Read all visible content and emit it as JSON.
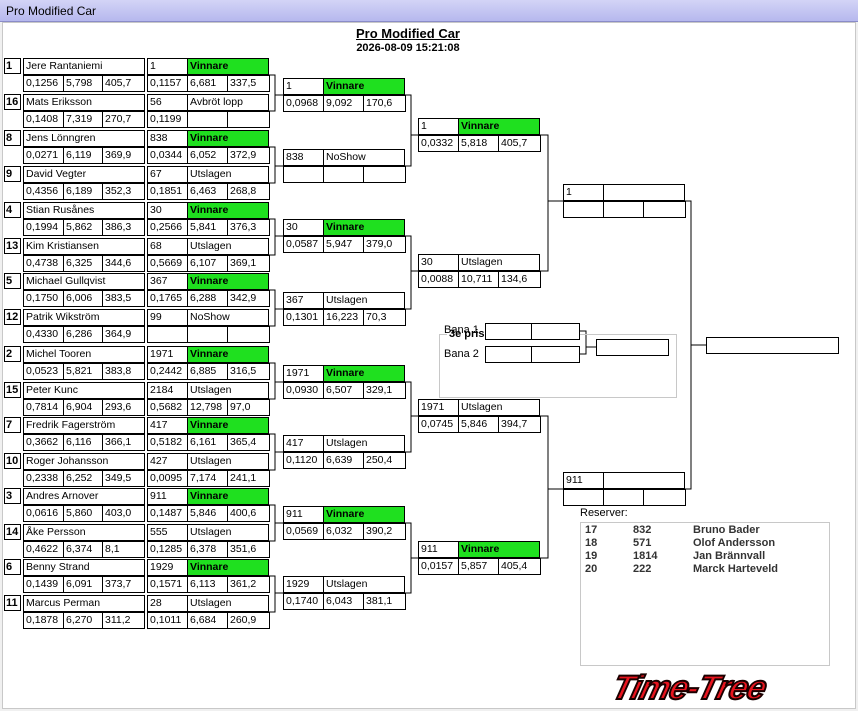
{
  "window": {
    "title": "Pro Modified Car"
  },
  "header": {
    "title": "Pro Modified Car",
    "datetime": "2026-08-09 15:21:08"
  },
  "round1": [
    {
      "seed": "1",
      "name": "Jere Rantaniemi",
      "stats": [
        "0,1256",
        "5,798",
        "405,7"
      ],
      "car": "1",
      "result": "Vinnare",
      "win": true,
      "rstats": [
        "0,1157",
        "6,681",
        "337,5"
      ]
    },
    {
      "seed": "16",
      "name": "Mats Eriksson",
      "stats": [
        "0,1408",
        "7,319",
        "270,7"
      ],
      "car": "56",
      "result": "Avbröt lopp",
      "win": false,
      "rstats": [
        "0,1199",
        "",
        ""
      ]
    },
    {
      "seed": "8",
      "name": "Jens Lönngren",
      "stats": [
        "0,0271",
        "6,119",
        "369,9"
      ],
      "car": "838",
      "result": "Vinnare",
      "win": true,
      "rstats": [
        "0,0344",
        "6,052",
        "372,9"
      ]
    },
    {
      "seed": "9",
      "name": "David Vegter",
      "stats": [
        "0,4356",
        "6,189",
        "352,3"
      ],
      "car": "67",
      "result": "Utslagen",
      "win": false,
      "rstats": [
        "0,1851",
        "6,463",
        "268,8"
      ]
    },
    {
      "seed": "4",
      "name": "Stian Rusånes",
      "stats": [
        "0,1994",
        "5,862",
        "386,3"
      ],
      "car": "30",
      "result": "Vinnare",
      "win": true,
      "rstats": [
        "0,2566",
        "5,841",
        "376,3"
      ]
    },
    {
      "seed": "13",
      "name": "Kim Kristiansen",
      "stats": [
        "0,4738",
        "6,325",
        "344,6"
      ],
      "car": "68",
      "result": "Utslagen",
      "win": false,
      "rstats": [
        "0,5669",
        "6,107",
        "369,1"
      ]
    },
    {
      "seed": "5",
      "name": "Michael Gullqvist",
      "stats": [
        "0,1750",
        "6,006",
        "383,5"
      ],
      "car": "367",
      "result": "Vinnare",
      "win": true,
      "rstats": [
        "0,1765",
        "6,288",
        "342,9"
      ]
    },
    {
      "seed": "12",
      "name": "Patrik Wikström",
      "stats": [
        "0,4330",
        "6,286",
        "364,9"
      ],
      "car": "99",
      "result": "NoShow",
      "win": false,
      "rstats": [
        "",
        "",
        ""
      ]
    },
    {
      "seed": "2",
      "name": "Michel Tooren",
      "stats": [
        "0,0523",
        "5,821",
        "383,8"
      ],
      "car": "1971",
      "result": "Vinnare",
      "win": true,
      "rstats": [
        "0,2442",
        "6,885",
        "316,5"
      ]
    },
    {
      "seed": "15",
      "name": "Peter  Kunc",
      "stats": [
        "0,7814",
        "6,904",
        "293,6"
      ],
      "car": "2184",
      "result": "Utslagen",
      "win": false,
      "rstats": [
        "0,5682",
        "12,798",
        "97,0"
      ]
    },
    {
      "seed": "7",
      "name": "Fredrik Fagerström",
      "stats": [
        "0,3662",
        "6,116",
        "366,1"
      ],
      "car": "417",
      "result": "Vinnare",
      "win": true,
      "rstats": [
        "0,5182",
        "6,161",
        "365,4"
      ]
    },
    {
      "seed": "10",
      "name": "Roger Johansson",
      "stats": [
        "0,2338",
        "6,252",
        "349,5"
      ],
      "car": "427",
      "result": "Utslagen",
      "win": false,
      "rstats": [
        "0,0095",
        "7,174",
        "241,1"
      ]
    },
    {
      "seed": "3",
      "name": "Andres Arnover",
      "stats": [
        "0,0616",
        "5,860",
        "403,0"
      ],
      "car": "911",
      "result": "Vinnare",
      "win": true,
      "rstats": [
        "0,1487",
        "5,846",
        "400,6"
      ]
    },
    {
      "seed": "14",
      "name": "Åke Persson",
      "stats": [
        "0,4622",
        "6,374",
        "8,1"
      ],
      "car": "555",
      "result": "Utslagen",
      "win": false,
      "rstats": [
        "0,1285",
        "6,378",
        "351,6"
      ]
    },
    {
      "seed": "6",
      "name": "Benny Strand",
      "stats": [
        "0,1439",
        "6,091",
        "373,7"
      ],
      "car": "1929",
      "result": "Vinnare",
      "win": true,
      "rstats": [
        "0,1571",
        "6,113",
        "361,2"
      ]
    },
    {
      "seed": "11",
      "name": "Marcus Perman",
      "stats": [
        "0,1878",
        "6,270",
        "311,2"
      ],
      "car": "28",
      "result": "Utslagen",
      "win": false,
      "rstats": [
        "0,1011",
        "6,684",
        "260,9"
      ]
    }
  ],
  "quarter": [
    {
      "car": "1",
      "result": "Vinnare",
      "win": true,
      "stats": [
        "0,0968",
        "9,092",
        "170,6"
      ]
    },
    {
      "car": "838",
      "result": "NoShow",
      "win": false,
      "stats": [
        "",
        "",
        ""
      ]
    },
    {
      "car": "30",
      "result": "Vinnare",
      "win": true,
      "stats": [
        "0,0587",
        "5,947",
        "379,0"
      ]
    },
    {
      "car": "367",
      "result": "Utslagen",
      "win": false,
      "stats": [
        "0,1301",
        "16,223",
        "70,3"
      ]
    },
    {
      "car": "1971",
      "result": "Vinnare",
      "win": true,
      "stats": [
        "0,0930",
        "6,507",
        "329,1"
      ]
    },
    {
      "car": "417",
      "result": "Utslagen",
      "win": false,
      "stats": [
        "0,1120",
        "6,639",
        "250,4"
      ]
    },
    {
      "car": "911",
      "result": "Vinnare",
      "win": true,
      "stats": [
        "0,0569",
        "6,032",
        "390,2"
      ]
    },
    {
      "car": "1929",
      "result": "Utslagen",
      "win": false,
      "stats": [
        "0,1740",
        "6,043",
        "381,1"
      ]
    }
  ],
  "semi": [
    {
      "car": "1",
      "result": "Vinnare",
      "win": true,
      "stats": [
        "0,0332",
        "5,818",
        "405,7"
      ]
    },
    {
      "car": "30",
      "result": "Utslagen",
      "win": false,
      "stats": [
        "0,0088",
        "10,711",
        "134,6"
      ]
    },
    {
      "car": "1971",
      "result": "Utslagen",
      "win": false,
      "stats": [
        "0,0745",
        "5,846",
        "394,7"
      ]
    },
    {
      "car": "911",
      "result": "Vinnare",
      "win": true,
      "stats": [
        "0,0157",
        "5,857",
        "405,4"
      ]
    }
  ],
  "final": [
    {
      "car": "1",
      "result": "",
      "win": false,
      "stats": [
        "",
        "",
        ""
      ]
    },
    {
      "car": "911",
      "result": "",
      "win": false,
      "stats": [
        "",
        "",
        ""
      ]
    }
  ],
  "third": {
    "title": "3e pris",
    "lane1": "Bana 1",
    "lane2": "Bana 2"
  },
  "reserves": {
    "label": "Reserver:",
    "rows": [
      {
        "pos": "17",
        "no": "832",
        "name": "Bruno Bader"
      },
      {
        "pos": "18",
        "no": "571",
        "name": "Olof Andersson"
      },
      {
        "pos": "19",
        "no": "1814",
        "name": "Jan Brännvall"
      },
      {
        "pos": "20",
        "no": "222",
        "name": "Marck Harteveld"
      }
    ]
  },
  "logo": {
    "text": "Time-Tree"
  },
  "colors": {
    "winner": "#1fe01f",
    "logo": "#e8141e"
  }
}
